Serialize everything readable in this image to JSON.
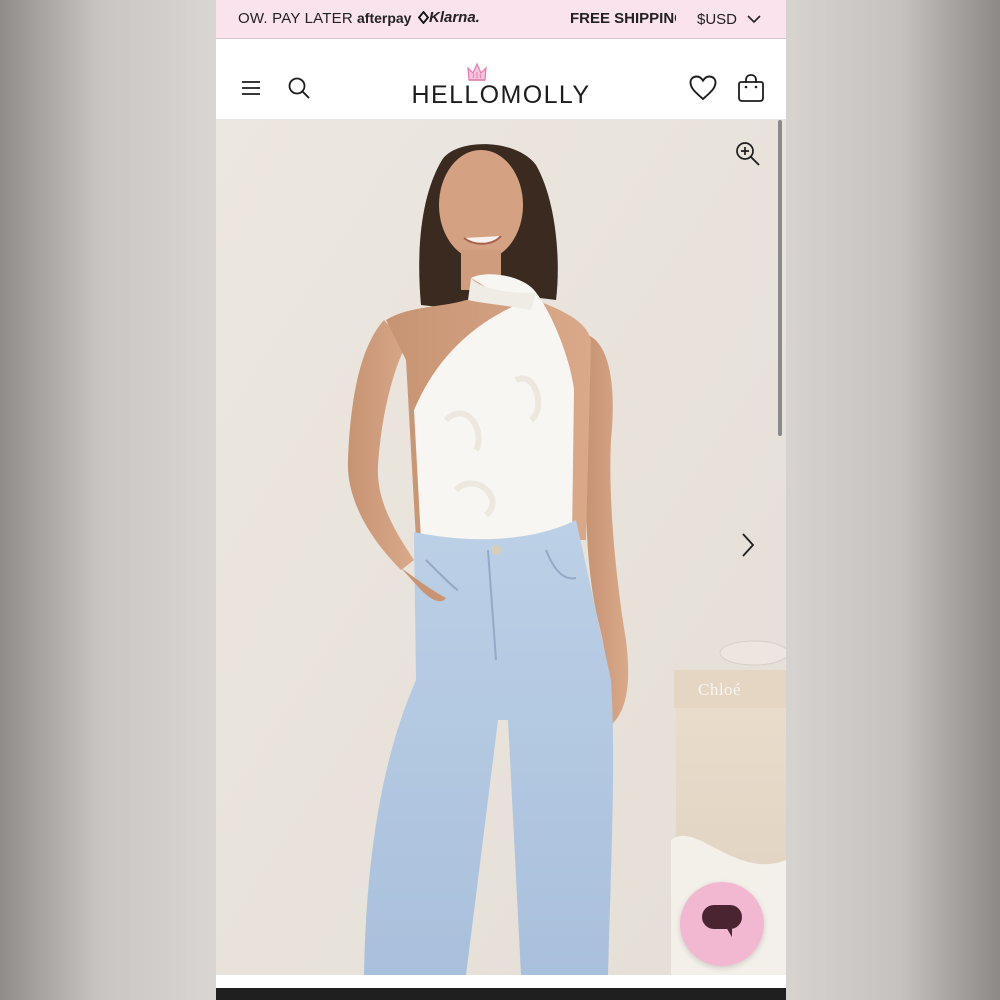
{
  "promo_bar": {
    "pay_later_text": "OW. PAY LATER",
    "afterpay_logo": "afterpay",
    "klarna_logo": "Klarna.",
    "shipping_text": "FREE SHIPPING",
    "currency": "$USD",
    "background_color": "#fbe3ee"
  },
  "header": {
    "logo_text": "HELLOMOLLY",
    "logo_accent_color": "#e47bb0",
    "icons": [
      "menu-icon",
      "search-icon",
      "heart-icon",
      "shopping-bag-icon"
    ]
  },
  "product_gallery": {
    "zoom_icon": "zoom-in-icon",
    "next_icon": "chevron-right-icon",
    "prop_label": "Chloé"
  },
  "chat": {
    "icon": "chat-bubble-icon",
    "color": "#f3b8d1"
  }
}
